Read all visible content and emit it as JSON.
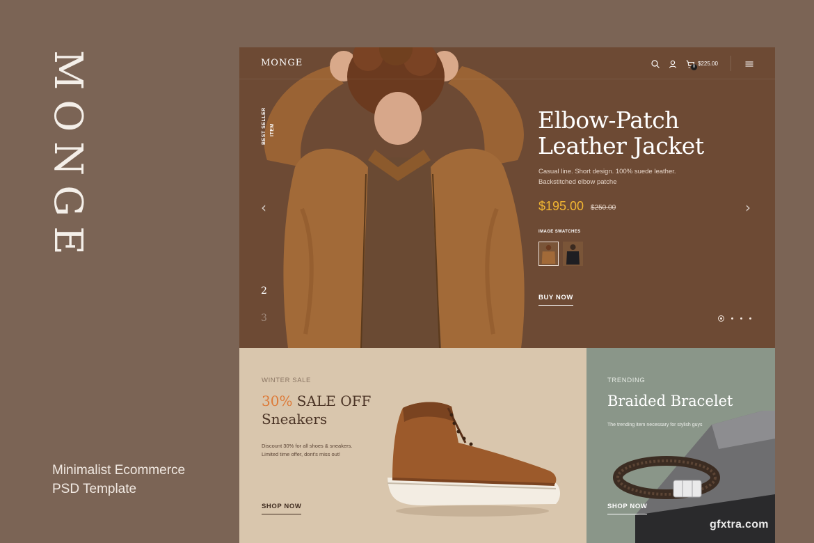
{
  "brand": {
    "vertical_logo": "MONGE",
    "tagline_line1": "Minimalist Ecommerce",
    "tagline_line2": "PSD Template"
  },
  "header": {
    "logo": "MONGE",
    "cart_total": "$225.00",
    "cart_count": "0",
    "icons": [
      "search-icon",
      "user-icon",
      "cart-icon",
      "menu-icon"
    ]
  },
  "hero": {
    "side_label_line1": "BEST SELLER",
    "side_label_line2": "ITEM",
    "slide_current": "2",
    "slide_next": "3",
    "title_line1": "Elbow-Patch",
    "title_line2": "Leather Jacket",
    "description_line1": "Casual line. Short design. 100% suede leather.",
    "description_line2": "Backstitched elbow patche",
    "price": "$195.00",
    "old_price": "$250.00",
    "swatch_label": "IMAGE SWATCHES",
    "cta": "BUY NOW",
    "dots_count": 4,
    "active_dot": 1
  },
  "promo_sale": {
    "eyebrow": "WINTER SALE",
    "title_accent": "30%",
    "title_rest": " SALE OFF",
    "title_line2": "Sneakers",
    "desc_line1": "Discount 30% for all shoes & sneakers.",
    "desc_line2": "Limited time offer, dont's miss out!",
    "cta": "SHOP NOW"
  },
  "promo_trend": {
    "eyebrow": "TRENDING",
    "title": "Braided Bracelet",
    "desc": "The trending item necessary for stylish guys",
    "cta": "SHOP NOW"
  },
  "watermark": "gfxtra.com",
  "colors": {
    "page_bg": "#7b6455",
    "hero_bg": "#6d4a34",
    "price": "#f2b632",
    "accent_orange": "#dd7a38",
    "sale_card": "#d9c6ad",
    "trend_card": "#8a9689"
  }
}
